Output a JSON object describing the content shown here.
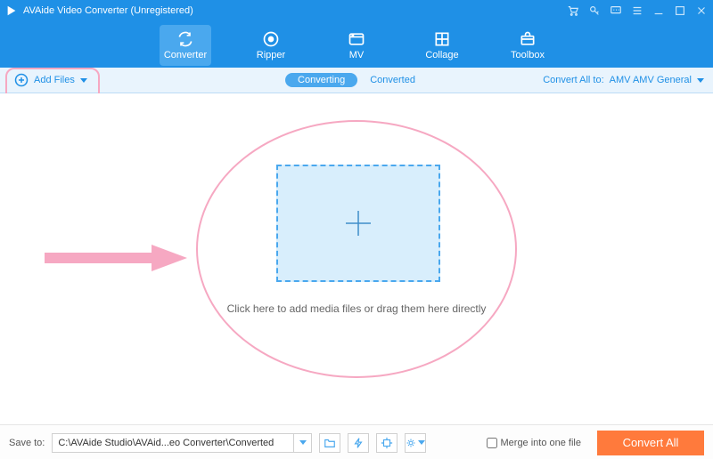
{
  "title": "AVAide Video Converter (Unregistered)",
  "toolbar": {
    "converter": "Converter",
    "ripper": "Ripper",
    "mv": "MV",
    "collage": "Collage",
    "toolbox": "Toolbox"
  },
  "subbar": {
    "add_files": "Add Files",
    "converting": "Converting",
    "converted": "Converted",
    "convert_all_to_label": "Convert All to:",
    "convert_all_to_value": "AMV AMV General"
  },
  "main": {
    "hint": "Click here to add media files or drag them here directly"
  },
  "bottom": {
    "save_to_label": "Save to:",
    "save_to_path": "C:\\AVAide Studio\\AVAid...eo Converter\\Converted",
    "merge_label": "Merge into one file",
    "convert_all_btn": "Convert All"
  },
  "icons": {
    "logo": "play-logo-icon",
    "cart": "cart-icon",
    "key": "key-icon",
    "chat": "chat-icon",
    "menu": "menu-icon",
    "minimize": "minimize-icon",
    "maximize": "maximize-icon",
    "close": "close-icon"
  }
}
